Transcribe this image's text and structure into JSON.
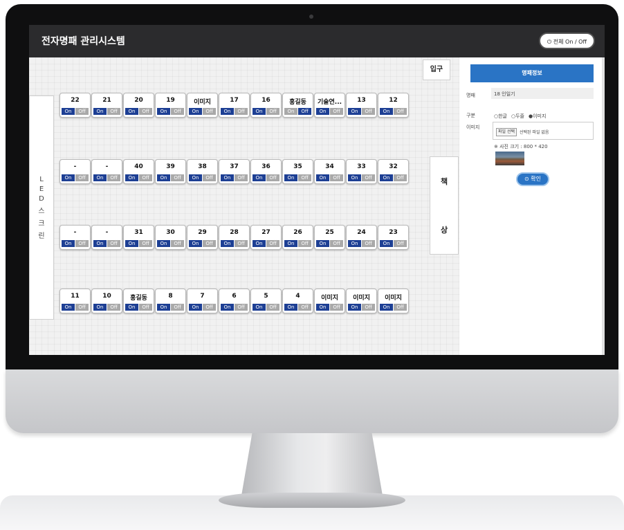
{
  "app": {
    "title": "전자명패 관리시스템",
    "power_label": "전체 On / Off",
    "power_icon": "power-icon"
  },
  "room": {
    "led_chars": [
      "L",
      "E",
      "D",
      "스",
      "크",
      "린"
    ],
    "entrance": "입구",
    "desk_chars": [
      "책",
      "상"
    ]
  },
  "toggle": {
    "on": "On",
    "off": "Off"
  },
  "seats": {
    "row1": [
      {
        "label": "22"
      },
      {
        "label": "21"
      },
      {
        "label": "20"
      },
      {
        "label": "19"
      },
      {
        "label": "이미지"
      },
      {
        "label": "17"
      },
      {
        "label": "16"
      },
      {
        "label": "홍길동",
        "disabled": true
      },
      {
        "label": "기술연..."
      },
      {
        "label": "13"
      },
      {
        "label": "12"
      }
    ],
    "row2": [
      {
        "label": "-"
      },
      {
        "label": "-"
      },
      {
        "label": "40"
      },
      {
        "label": "39"
      },
      {
        "label": "38"
      },
      {
        "label": "37"
      },
      {
        "label": "36"
      },
      {
        "label": "35"
      },
      {
        "label": "34"
      },
      {
        "label": "33"
      },
      {
        "label": "32"
      }
    ],
    "row3": [
      {
        "label": "-"
      },
      {
        "label": "-"
      },
      {
        "label": "31"
      },
      {
        "label": "30"
      },
      {
        "label": "29"
      },
      {
        "label": "28"
      },
      {
        "label": "27"
      },
      {
        "label": "26"
      },
      {
        "label": "25"
      },
      {
        "label": "24"
      },
      {
        "label": "23"
      }
    ],
    "row4": [
      {
        "label": "11"
      },
      {
        "label": "10"
      },
      {
        "label": "홍길동"
      },
      {
        "label": "8"
      },
      {
        "label": "7"
      },
      {
        "label": "6"
      },
      {
        "label": "5"
      },
      {
        "label": "4"
      },
      {
        "label": "이미지"
      },
      {
        "label": "이미지"
      },
      {
        "label": "이미지"
      }
    ]
  },
  "panel": {
    "header": "명패정보",
    "name_label": "명패",
    "name_value": "18 인일기",
    "type_label": "구분",
    "type_options": [
      "○한글",
      "○두줄",
      "●이미지"
    ],
    "image_label": "이미지",
    "choose_file": "파일 선택",
    "no_file": "선택된 파일 없음",
    "size_hint": "※ 사진 크기 : 800 * 420",
    "confirm": "확인",
    "confirm_icon": "check-circle-icon"
  }
}
